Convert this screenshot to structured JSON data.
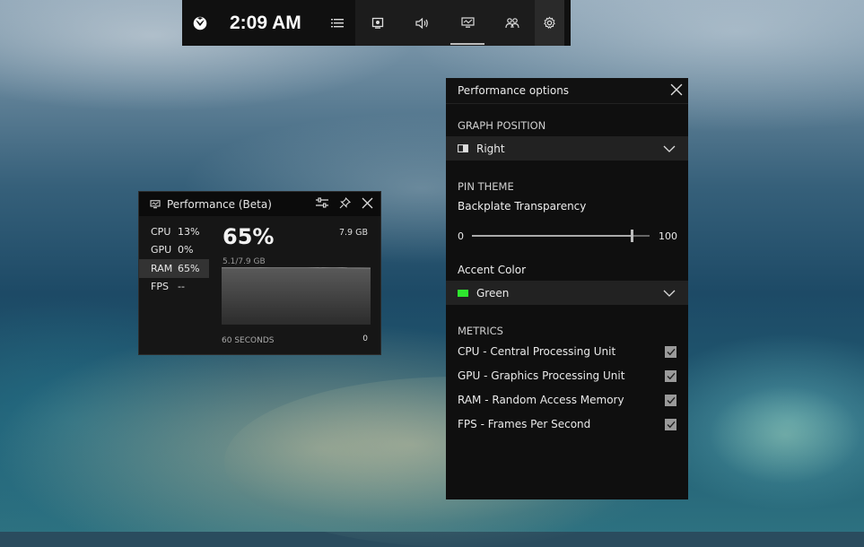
{
  "topbar": {
    "time": "2:09 AM",
    "icons": [
      "xbox-logo-icon",
      "menu-icon",
      "capture-icon",
      "audio-icon",
      "performance-icon",
      "social-icon",
      "gear-icon"
    ]
  },
  "perf_widget": {
    "title": "Performance (Beta)",
    "metrics": [
      {
        "name": "CPU",
        "value": "13%"
      },
      {
        "name": "GPU",
        "value": "0%"
      },
      {
        "name": "RAM",
        "value": "65%"
      },
      {
        "name": "FPS",
        "value": "--"
      }
    ],
    "selected_metric": "RAM",
    "big_value": "65%",
    "total": "7.9 GB",
    "used": "5.1/7.9 GB",
    "graph_label": "60 SECONDS",
    "graph_zero": "0",
    "graph_fill_fraction": 0.65
  },
  "options": {
    "title": "Performance options",
    "graph_position_label": "GRAPH POSITION",
    "graph_position_value": "Right",
    "pin_theme_label": "PIN THEME",
    "backplate_label": "Backplate Transparency",
    "slider_min": "0",
    "slider_max": "100",
    "slider_value": 90,
    "accent_color_label": "Accent Color",
    "accent_color_value": "Green",
    "accent_color_hex": "#2ee62e",
    "metrics_label": "METRICS",
    "metrics": [
      {
        "label": "CPU - Central Processing Unit",
        "checked": true
      },
      {
        "label": "GPU - Graphics Processing Unit",
        "checked": true
      },
      {
        "label": "RAM - Random Access Memory",
        "checked": true
      },
      {
        "label": "FPS - Frames Per Second",
        "checked": true
      }
    ]
  }
}
